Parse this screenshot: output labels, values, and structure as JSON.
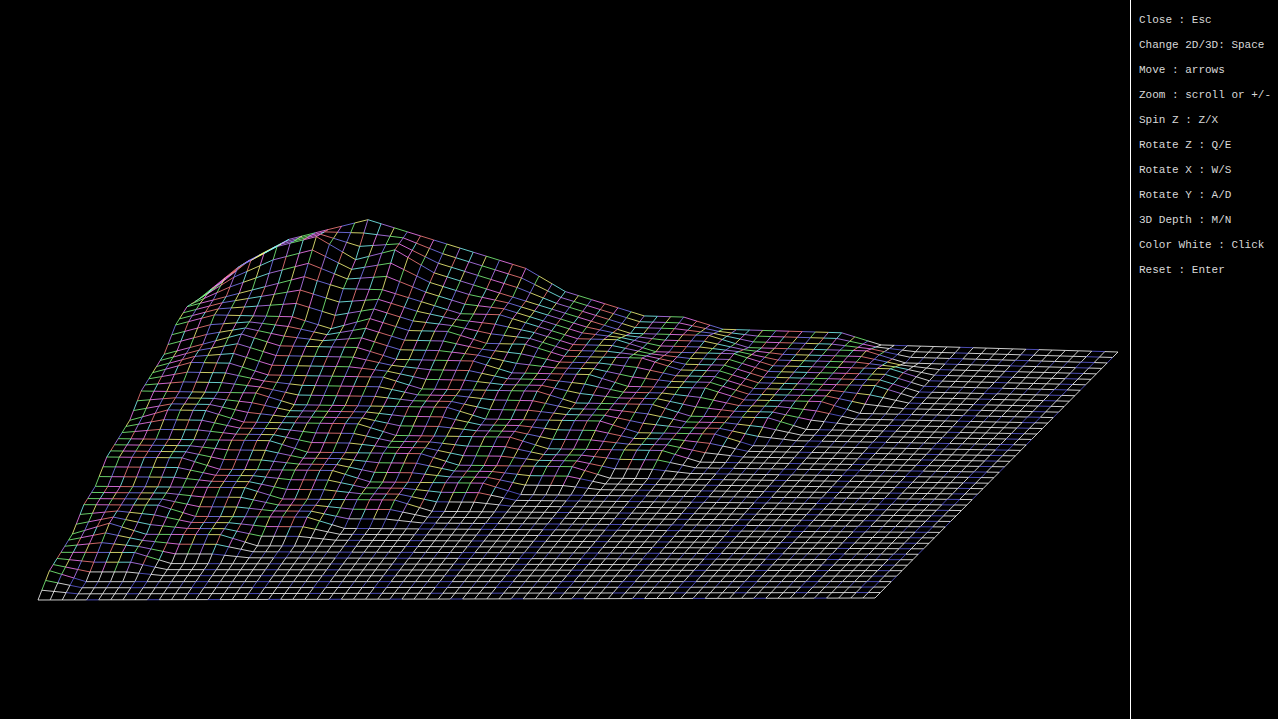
{
  "controls": [
    {
      "label": "Close : Esc"
    },
    {
      "label": "Change 2D/3D: Space"
    },
    {
      "label": "Move : arrows"
    },
    {
      "label": "Zoom : scroll or +/-"
    },
    {
      "label": "Spin Z : Z/X"
    },
    {
      "label": "Rotate Z : Q/E"
    },
    {
      "label": "Rotate X : W/S"
    },
    {
      "label": "Rotate Y : A/D"
    },
    {
      "label": "3D Depth : M/N"
    },
    {
      "label": "Color White : Click"
    },
    {
      "label": "Reset : Enter"
    }
  ],
  "map": {
    "heights": [
      [
        3,
        6,
        8,
        9,
        10,
        9,
        8,
        7,
        6,
        4,
        3,
        2,
        2,
        1,
        1,
        1,
        1,
        0,
        0,
        0,
        0,
        0,
        0,
        0
      ],
      [
        4,
        7,
        9,
        10,
        8,
        9,
        7,
        6,
        5,
        4,
        3,
        2,
        2,
        2,
        1,
        1,
        1,
        1,
        0,
        0,
        0,
        0,
        0,
        0
      ],
      [
        5,
        6,
        7,
        8,
        7,
        7,
        6,
        5,
        5,
        4,
        3,
        3,
        2,
        2,
        2,
        1,
        1,
        1,
        1,
        0,
        0,
        0,
        0,
        0
      ],
      [
        5,
        6,
        6,
        6,
        5,
        6,
        5,
        5,
        4,
        4,
        3,
        3,
        3,
        2,
        2,
        1,
        1,
        1,
        1,
        0,
        0,
        0,
        0,
        0
      ],
      [
        4,
        5,
        6,
        5,
        5,
        5,
        4,
        4,
        4,
        3,
        3,
        3,
        2,
        2,
        2,
        1,
        1,
        1,
        0,
        0,
        0,
        0,
        0,
        0
      ],
      [
        4,
        5,
        5,
        4,
        4,
        4,
        4,
        3,
        3,
        3,
        3,
        2,
        2,
        2,
        1,
        1,
        1,
        0,
        0,
        0,
        0,
        0,
        0,
        0
      ],
      [
        4,
        4,
        4,
        4,
        3,
        3,
        3,
        3,
        3,
        2,
        2,
        2,
        2,
        1,
        1,
        1,
        0,
        0,
        0,
        0,
        0,
        0,
        0,
        0
      ],
      [
        3,
        4,
        4,
        3,
        3,
        3,
        3,
        2,
        2,
        2,
        2,
        1,
        1,
        1,
        1,
        0,
        0,
        0,
        0,
        0,
        0,
        0,
        0,
        0
      ],
      [
        3,
        3,
        3,
        3,
        3,
        2,
        2,
        2,
        2,
        1,
        1,
        1,
        1,
        0,
        0,
        0,
        0,
        0,
        0,
        0,
        0,
        0,
        0,
        0
      ],
      [
        3,
        3,
        3,
        2,
        2,
        2,
        2,
        1,
        1,
        1,
        1,
        0,
        0,
        0,
        0,
        0,
        0,
        0,
        0,
        0,
        0,
        0,
        0,
        0
      ],
      [
        2,
        2,
        2,
        2,
        2,
        1,
        1,
        1,
        1,
        0,
        0,
        0,
        0,
        0,
        0,
        0,
        0,
        0,
        0,
        0,
        0,
        0,
        0,
        0
      ],
      [
        2,
        2,
        2,
        1,
        1,
        1,
        1,
        0,
        0,
        0,
        0,
        0,
        0,
        0,
        0,
        0,
        0,
        0,
        0,
        0,
        0,
        0,
        0,
        0
      ],
      [
        1,
        2,
        1,
        1,
        1,
        0,
        0,
        0,
        0,
        0,
        0,
        0,
        0,
        0,
        0,
        0,
        0,
        0,
        0,
        0,
        0,
        0,
        0,
        0
      ],
      [
        1,
        1,
        1,
        0,
        0,
        0,
        0,
        0,
        0,
        0,
        0,
        0,
        0,
        0,
        0,
        0,
        0,
        0,
        0,
        0,
        0,
        0,
        0,
        0
      ],
      [
        1,
        0,
        0,
        0,
        0,
        0,
        0,
        0,
        0,
        0,
        0,
        0,
        0,
        0,
        0,
        0,
        0,
        0,
        0,
        0,
        0,
        0,
        0,
        0
      ],
      [
        0,
        0,
        0,
        0,
        0,
        0,
        0,
        0,
        0,
        0,
        0,
        0,
        0,
        0,
        0,
        0,
        0,
        0,
        0,
        0,
        0,
        0,
        0,
        0
      ]
    ]
  }
}
